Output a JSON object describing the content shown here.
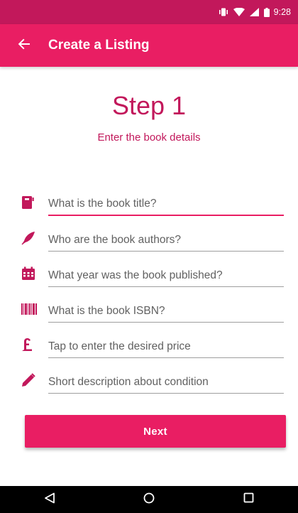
{
  "status_bar": {
    "time": "9:28",
    "icons": [
      "vibrate-icon",
      "wifi-icon",
      "signal-icon",
      "battery-icon"
    ]
  },
  "app_bar": {
    "title": "Create a Listing",
    "back_icon": "arrow-back-icon"
  },
  "heading": {
    "title": "Step 1",
    "subtitle": "Enter the book details"
  },
  "form": {
    "fields": [
      {
        "icon": "book-icon",
        "placeholder": "What is the book title?",
        "value": ""
      },
      {
        "icon": "quill-icon",
        "placeholder": "Who are the book authors?",
        "value": ""
      },
      {
        "icon": "calendar-icon",
        "placeholder": "What year was the book published?",
        "value": ""
      },
      {
        "icon": "barcode-icon",
        "placeholder": "What is the book ISBN?",
        "value": ""
      },
      {
        "icon": "pound-icon",
        "placeholder": "Tap to enter the desired price",
        "value": ""
      },
      {
        "icon": "pencil-icon",
        "placeholder": "Short description about condition",
        "value": ""
      }
    ]
  },
  "next_button": {
    "label": "Next"
  },
  "nav_bar": {
    "icons": [
      "back-triangle-icon",
      "home-circle-icon",
      "recents-square-icon"
    ]
  },
  "colors": {
    "primary": "#e91e63",
    "primary_dark": "#c2185b",
    "text": "#212121",
    "hint": "#616161"
  }
}
